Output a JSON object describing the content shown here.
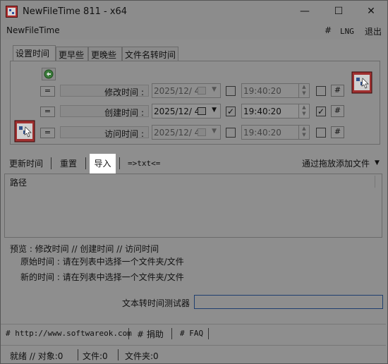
{
  "window": {
    "title": "NewFileTime 811 - x64",
    "minimize_glyph": "—",
    "maximize_glyph": "☐",
    "close_glyph": "✕"
  },
  "menubar": {
    "app": "NewFileTime",
    "hash": "#",
    "lng": "LNG",
    "exit": "退出"
  },
  "tabs": [
    "设置时间",
    "更早些",
    "更晚些",
    "文件名转时间"
  ],
  "rows": [
    {
      "eq": "=",
      "label": "修改时间 :",
      "date": "2025/12/ 4",
      "date_checked": false,
      "time": "19:40:20",
      "time_checked": false,
      "hash": "#"
    },
    {
      "eq": "=",
      "label": "创建时间 :",
      "date": "2025/12/ 4",
      "date_checked": true,
      "time": "19:40:20",
      "time_checked": true,
      "hash": "#"
    },
    {
      "eq": "=",
      "label": "访问时间 :",
      "date": "2025/12/ 4",
      "date_checked": false,
      "time": "19:40:20",
      "time_checked": false,
      "hash": "#"
    }
  ],
  "toolbar": {
    "update": "更新时间",
    "reset": "重置",
    "import": "导入",
    "txt": "=>txt<=",
    "add_by_drag": "通过拖放添加文件",
    "dropdown": "▼"
  },
  "list": {
    "column_path": "路径"
  },
  "preview": {
    "header": "预览 :  修改时间   //  创建时间   //  访问时间",
    "original": "原始时间 : 请在列表中选择一个文件夹/文件",
    "new": "新的时间 : 请在列表中选择一个文件夹/文件"
  },
  "tester": {
    "label": "文本转时间测试器",
    "value": ""
  },
  "footer": {
    "url": "# http://www.softwareok.com",
    "donate": "# 捐助",
    "faq": "# FAQ"
  },
  "status": {
    "ready": "就绪 // 对象:0",
    "files": "文件:0",
    "folders": "文件夹:0"
  },
  "icons": {
    "app": "newfiletime-app-icon",
    "refresh": "refresh-icon"
  },
  "colors": {
    "accent_input_border": "#1f3f6f",
    "highlight": "#ffffff"
  }
}
